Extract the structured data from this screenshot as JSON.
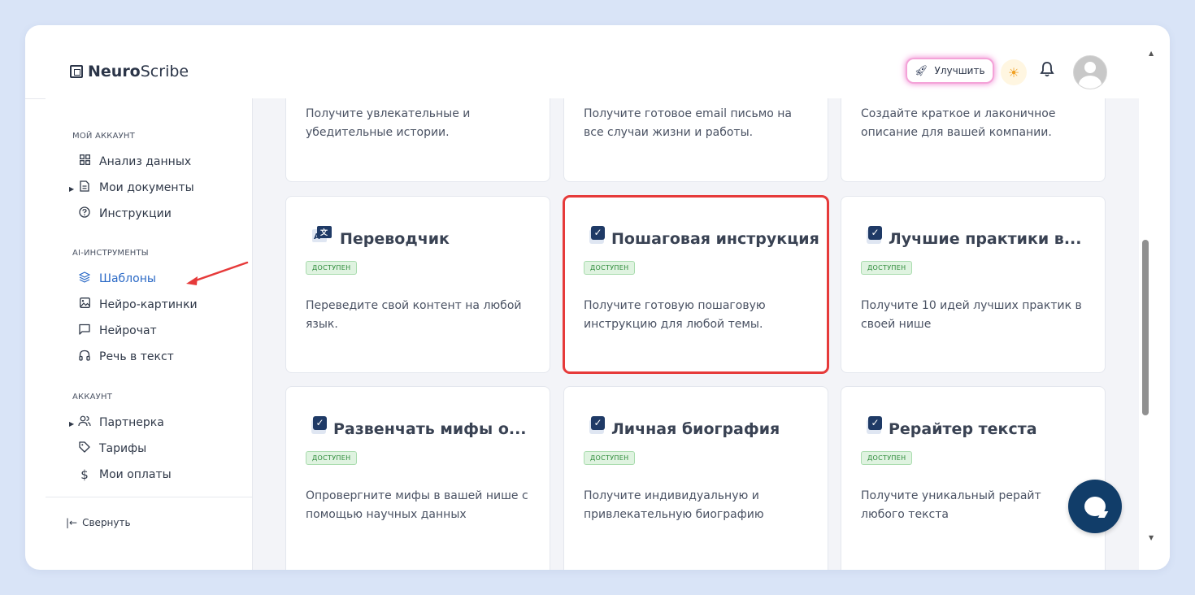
{
  "header": {
    "logo_bold": "Neuro",
    "logo_regular": "Scribe",
    "upgrade_label": "Улучшить"
  },
  "sidebar": {
    "sections": [
      {
        "title": "МОЙ АККАУНТ"
      },
      {
        "title": "AI-ИНСТРУМЕНТЫ"
      },
      {
        "title": "АККАУНТ"
      }
    ],
    "items": [
      {
        "label": "Анализ данных",
        "icon": "grid-icon"
      },
      {
        "label": "Мои документы",
        "icon": "document-icon"
      },
      {
        "label": "Инструкции",
        "icon": "help-circle-icon"
      },
      {
        "label": "Шаблоны",
        "icon": "layers-icon",
        "active": true
      },
      {
        "label": "Нейро-картинки",
        "icon": "image-icon"
      },
      {
        "label": "Нейрочат",
        "icon": "chat-icon"
      },
      {
        "label": "Речь в текст",
        "icon": "headphones-icon"
      },
      {
        "label": "Партнерка",
        "icon": "users-icon"
      },
      {
        "label": "Тарифы",
        "icon": "tag-icon"
      },
      {
        "label": "Мои оплаты",
        "icon": "dollar-icon"
      }
    ],
    "collapse_label": "Свернуть"
  },
  "cards": [
    {
      "title": "",
      "badge": "",
      "desc": "Получите увлекательные и убедительные истории."
    },
    {
      "title": "",
      "badge": "",
      "desc": "Получите готовое email письмо на все случаи жизни и работы."
    },
    {
      "title": "",
      "badge": "",
      "desc": "Создайте краткое и лаконичное описание для вашей компании."
    },
    {
      "title": "Переводчик",
      "badge": "ДОСТУПЕН",
      "desc": "Переведите свой контент на любой язык.",
      "icon": "translate-icon"
    },
    {
      "title": "Пошаговая инструкция",
      "badge": "ДОСТУПЕН",
      "desc": "Получите готовую пошаговую инструкцию для любой темы.",
      "icon": "checkbox-icon"
    },
    {
      "title": "Лучшие практики в...",
      "badge": "ДОСТУПЕН",
      "desc": "Получите 10 идей лучших практик в своей нише",
      "icon": "checkbox-icon"
    },
    {
      "title": "Развенчать мифы о...",
      "badge": "ДОСТУПЕН",
      "desc": "Опровергните мифы в вашей нише с помощью научных данных",
      "icon": "checkbox-icon"
    },
    {
      "title": "Личная биография",
      "badge": "ДОСТУПЕН",
      "desc": "Получите индивидуальную и привлекательную биографию",
      "icon": "checkbox-icon"
    },
    {
      "title": "Рерайтер текста",
      "badge": "ДОСТУПЕН",
      "desc": "Получите уникальный рерайт любого текста",
      "icon": "checkbox-icon"
    }
  ],
  "colors": {
    "accent": "#2a69c6",
    "highlight": "#e63a3a",
    "badge_bg": "#dff3e0",
    "badge_text": "#2e8b3a",
    "chat_button": "#113d69"
  }
}
